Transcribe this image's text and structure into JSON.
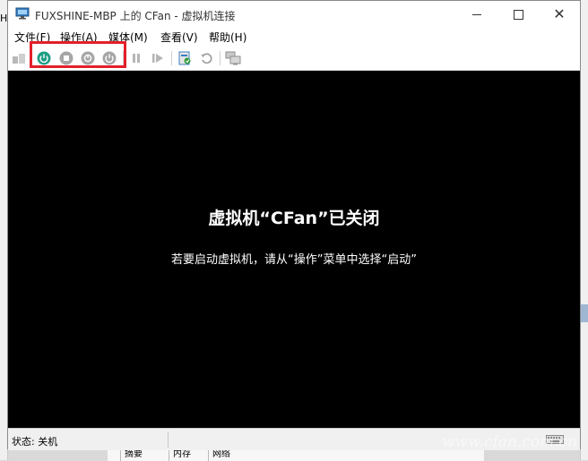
{
  "window": {
    "title": "FUXSHINE-MBP 上的 CFan - 虚拟机连接"
  },
  "menu": [
    "文件(F)",
    "操作(A)",
    "媒体(M)",
    "查看(V)",
    "帮助(H)"
  ],
  "toolbar": {
    "icons": [
      "ctrl-alt-del-icon",
      "start-icon",
      "turn-off-icon",
      "shutdown-icon",
      "save-state-icon",
      "pause-icon",
      "resume-icon",
      "checkpoint-icon",
      "revert-icon",
      "enhanced-session-icon"
    ],
    "accent_start": "#1f9e84",
    "disabled": "#a6a6a6",
    "highlight_color": "#e3202a"
  },
  "screen": {
    "title": "虚拟机“CFan”已关闭",
    "hint": "若要启动虚拟机，请从“操作”菜单中选择“启动”"
  },
  "status": {
    "text": "状态: 关机"
  },
  "background": {
    "left_label": "H",
    "bottom_cells": [
      "摘要",
      "内存",
      "网络"
    ]
  },
  "watermark": "www.cfan.com.cn"
}
